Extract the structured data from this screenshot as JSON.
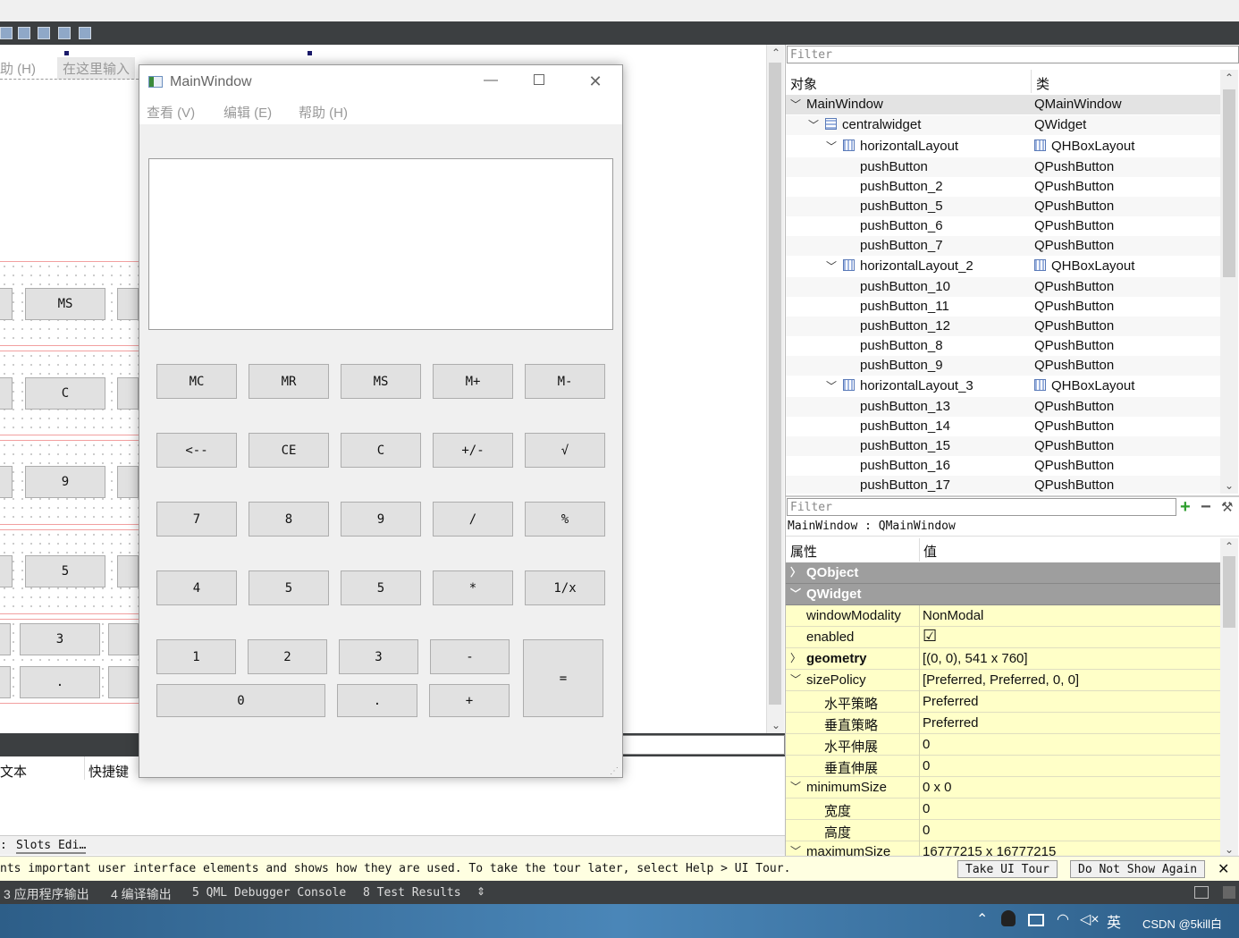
{
  "editor": {
    "menu_help": "助 (H)",
    "menu_type_here": "在这里输入",
    "bg_buttons": [
      "MS",
      "C",
      "9",
      "5",
      "3",
      "."
    ]
  },
  "calculator": {
    "title": "MainWindow",
    "menu": [
      "查看 (V)",
      "编辑 (E)",
      "帮助 (H)"
    ],
    "row1": [
      "MC",
      "MR",
      "MS",
      "M+",
      "M-"
    ],
    "row2": [
      "<--",
      "CE",
      "C",
      "+/-",
      "√"
    ],
    "row3": [
      "7",
      "8",
      "9",
      "/",
      "%"
    ],
    "row4": [
      "4",
      "5",
      "5",
      "*",
      "1/x"
    ],
    "row5": [
      "1",
      "2",
      "3",
      "-"
    ],
    "row6": [
      "0",
      ".",
      "+"
    ],
    "equals": "="
  },
  "object_inspector": {
    "filter_placeholder": "Filter",
    "col_object": "对象",
    "col_class": "类",
    "rows": [
      {
        "name": "MainWindow",
        "cls": "QMainWindow"
      },
      {
        "name": "centralwidget",
        "cls": "QWidget"
      },
      {
        "name": "horizontalLayout",
        "cls": "QHBoxLayout"
      },
      {
        "name": "pushButton",
        "cls": "QPushButton"
      },
      {
        "name": "pushButton_2",
        "cls": "QPushButton"
      },
      {
        "name": "pushButton_5",
        "cls": "QPushButton"
      },
      {
        "name": "pushButton_6",
        "cls": "QPushButton"
      },
      {
        "name": "pushButton_7",
        "cls": "QPushButton"
      },
      {
        "name": "horizontalLayout_2",
        "cls": "QHBoxLayout"
      },
      {
        "name": "pushButton_10",
        "cls": "QPushButton"
      },
      {
        "name": "pushButton_11",
        "cls": "QPushButton"
      },
      {
        "name": "pushButton_12",
        "cls": "QPushButton"
      },
      {
        "name": "pushButton_8",
        "cls": "QPushButton"
      },
      {
        "name": "pushButton_9",
        "cls": "QPushButton"
      },
      {
        "name": "horizontalLayout_3",
        "cls": "QHBoxLayout"
      },
      {
        "name": "pushButton_13",
        "cls": "QPushButton"
      },
      {
        "name": "pushButton_14",
        "cls": "QPushButton"
      },
      {
        "name": "pushButton_15",
        "cls": "QPushButton"
      },
      {
        "name": "pushButton_16",
        "cls": "QPushButton"
      },
      {
        "name": "pushButton_17",
        "cls": "QPushButton"
      }
    ]
  },
  "property_editor": {
    "filter_placeholder": "Filter",
    "object_label": "MainWindow : QMainWindow",
    "col_property": "属性",
    "col_value": "值",
    "rows": [
      {
        "key": "QObject",
        "value": ""
      },
      {
        "key": "QWidget",
        "value": ""
      },
      {
        "key": "windowModality",
        "value": "NonModal"
      },
      {
        "key": "enabled",
        "value": "☑"
      },
      {
        "key": "geometry",
        "value": "[(0, 0), 541 x 760]"
      },
      {
        "key": "sizePolicy",
        "value": "[Preferred, Preferred, 0, 0]"
      },
      {
        "key": "水平策略",
        "value": "Preferred"
      },
      {
        "key": "垂直策略",
        "value": "Preferred"
      },
      {
        "key": "水平伸展",
        "value": "0"
      },
      {
        "key": "垂直伸展",
        "value": "0"
      },
      {
        "key": "minimumSize",
        "value": "0 x 0"
      },
      {
        "key": "宽度",
        "value": "0"
      },
      {
        "key": "高度",
        "value": "0"
      },
      {
        "key": "maximumSize",
        "value": "16777215 x 16777215"
      }
    ]
  },
  "action_editor": {
    "col_text": "文本",
    "col_shortcut": "快捷键"
  },
  "slots_tab": "Slots Edi…",
  "tour": {
    "message": "nts important user interface elements and shows how they are used. To take the tour later, select Help > UI Tour.",
    "take_tour": "Take UI Tour",
    "dont_show": "Do Not Show Again",
    "close": "✕"
  },
  "output_tabs": [
    "3 应用程序输出",
    "4 编译输出",
    "5 QML Debugger Console",
    "8 Test Results"
  ],
  "taskbar": {
    "ime": "英",
    "watermark": "CSDN @5kill白"
  },
  "colors": {
    "dark_bar": "#3c3f41",
    "group_row": "#9e9e9e",
    "prop_row": "#ffffc8",
    "tour_bg": "#ffffe1"
  }
}
